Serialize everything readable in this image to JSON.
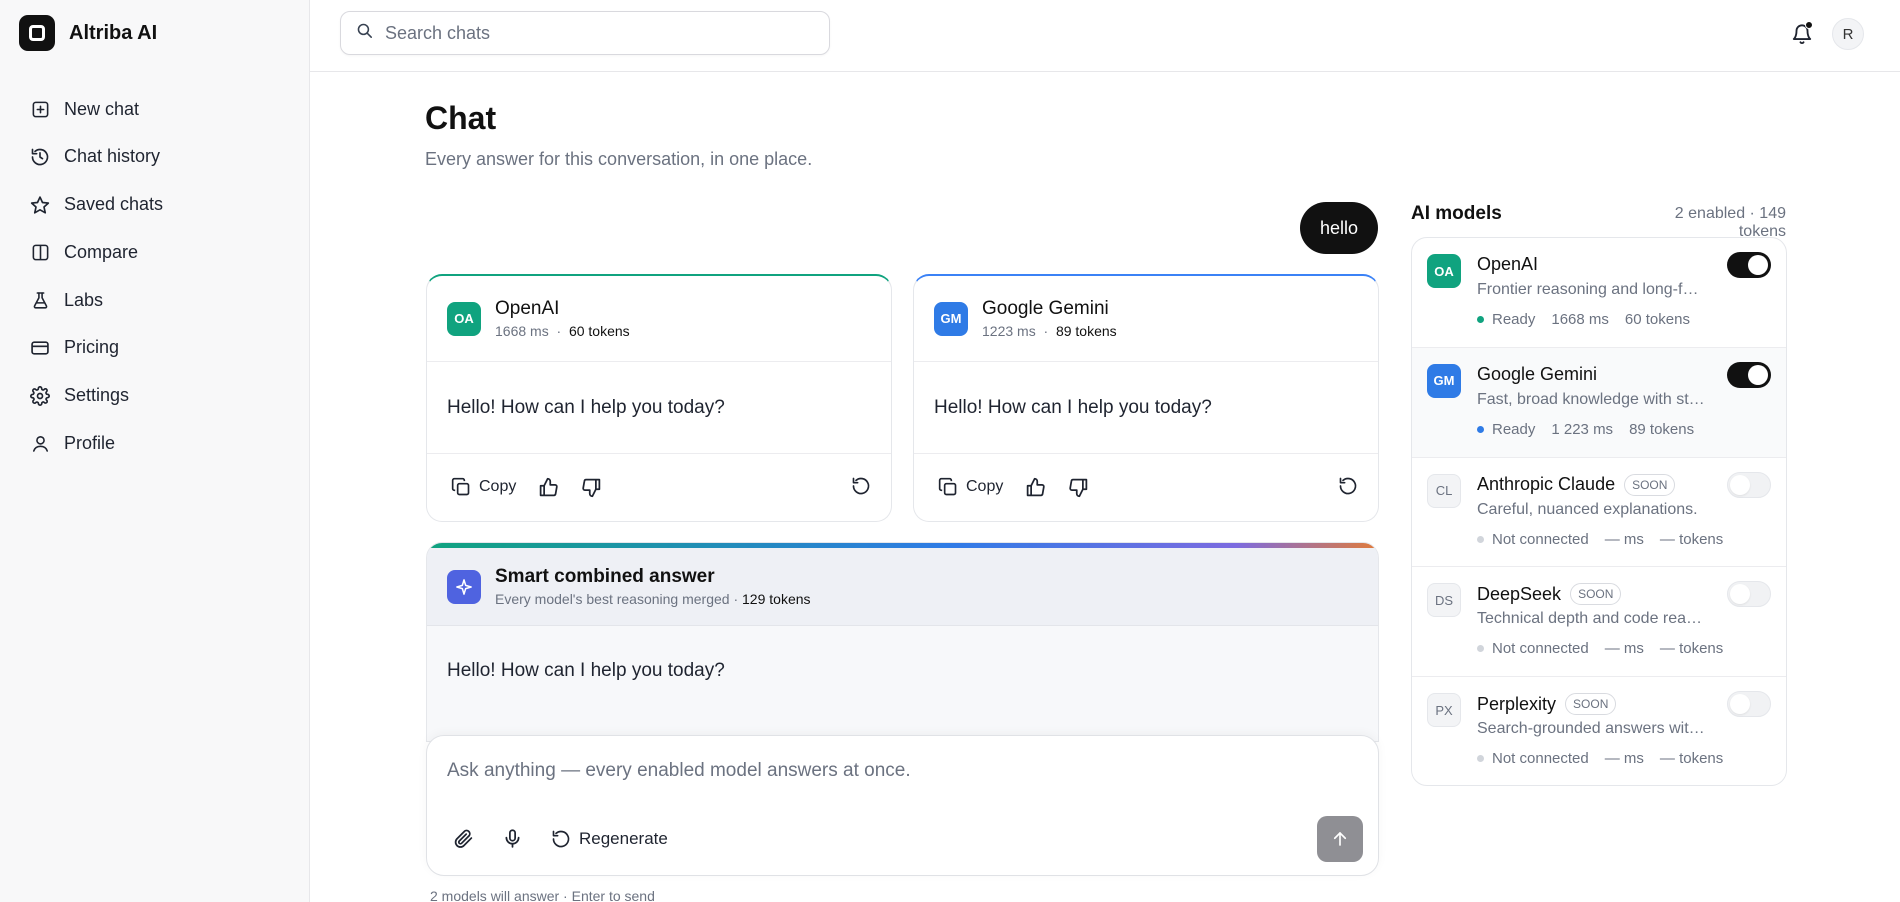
{
  "app": {
    "name": "Altriba AI"
  },
  "sidebar": {
    "items": [
      {
        "label": "New chat",
        "icon": "plus-square-icon"
      },
      {
        "label": "Chat history",
        "icon": "history-icon"
      },
      {
        "label": "Saved chats",
        "icon": "star-icon"
      },
      {
        "label": "Compare",
        "icon": "columns-icon"
      },
      {
        "label": "Labs",
        "icon": "flask-icon"
      },
      {
        "label": "Pricing",
        "icon": "credit-card-icon"
      },
      {
        "label": "Settings",
        "icon": "gear-icon"
      },
      {
        "label": "Profile",
        "icon": "user-icon"
      }
    ]
  },
  "header": {
    "search_placeholder": "Search chats",
    "avatar_initial": "R"
  },
  "page": {
    "title": "Chat",
    "subtitle": "Every answer for this conversation, in one place."
  },
  "conversation": {
    "user_message": "hello",
    "responses": [
      {
        "badge": "OA",
        "name": "OpenAI",
        "latency": "1668 ms",
        "separator": "·",
        "tokens": "60 tokens",
        "text": "Hello! How can I help you today?",
        "copy_label": "Copy"
      },
      {
        "badge": "GM",
        "name": "Google Gemini",
        "latency": "1223 ms",
        "separator": "·",
        "tokens": "89 tokens",
        "text": "Hello! How can I help you today?",
        "copy_label": "Copy"
      }
    ],
    "combined": {
      "title": "Smart combined answer",
      "meta": "Every model's best reasoning merged · ",
      "tokens": "129 tokens",
      "text": "Hello! How can I help you today?"
    }
  },
  "composer": {
    "placeholder": "Ask anything — every enabled model answers at once.",
    "regenerate_label": "Regenerate",
    "hint": "2 models will answer · Enter to send"
  },
  "models_panel": {
    "title": "AI models",
    "summary": "2 enabled · 149 tokens",
    "models": [
      {
        "badge": "OA",
        "name": "OpenAI",
        "soon": "",
        "desc": "Frontier reasoning and long-form answers.",
        "status": "Ready",
        "latency": "1668 ms",
        "tokens": "60 tokens",
        "enabled": true
      },
      {
        "badge": "GM",
        "name": "Google Gemini",
        "soon": "",
        "desc": "Fast, broad knowledge with strong multimodal grounding.",
        "status": "Ready",
        "latency": "1 223 ms",
        "tokens": "89 tokens",
        "enabled": true
      },
      {
        "badge": "CL",
        "name": "Anthropic Claude",
        "soon": "SOON",
        "desc": "Careful, nuanced explanations.",
        "status": "Not connected",
        "latency": "— ms",
        "tokens": "— tokens",
        "enabled": false
      },
      {
        "badge": "DS",
        "name": "DeepSeek",
        "soon": "SOON",
        "desc": "Technical depth and code reasoning.",
        "status": "Not connected",
        "latency": "— ms",
        "tokens": "— tokens",
        "enabled": false
      },
      {
        "badge": "PX",
        "name": "Perplexity",
        "soon": "SOON",
        "desc": "Search-grounded answers with citations.",
        "status": "Not connected",
        "latency": "— ms",
        "tokens": "— tokens",
        "enabled": false
      }
    ]
  },
  "colors": {
    "openai": "#10a37f",
    "gemini": "#2f7be6",
    "smart": "#4f63e0",
    "ready_dot_openai": "#10a37f",
    "ready_dot_gemini": "#2f7be6",
    "not_connected_dot": "#d1d5db"
  }
}
